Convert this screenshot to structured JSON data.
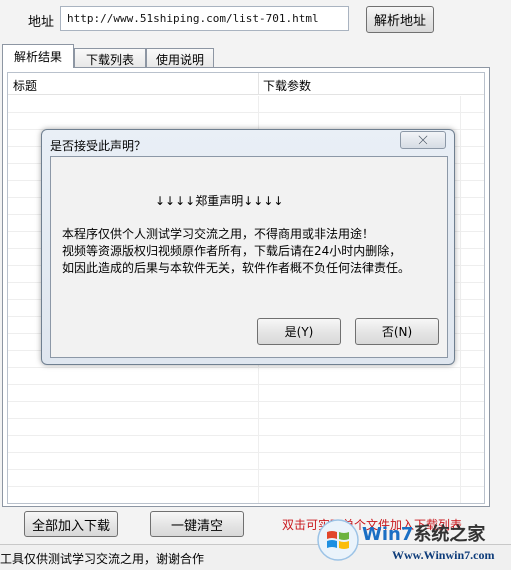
{
  "url_bar": {
    "label": "地址",
    "value": "http://www.51shiping.com/list-701.html",
    "parse_button": "解析地址"
  },
  "tabs": [
    {
      "label": "解析结果",
      "active": true
    },
    {
      "label": "下载列表",
      "active": false
    },
    {
      "label": "使用说明",
      "active": false
    }
  ],
  "list": {
    "columns": [
      "标题",
      "下载参数"
    ]
  },
  "bottom": {
    "add_all_button": "全部加入下载",
    "clear_button": "一键清空",
    "hint": "双击可实现单个文件加入下载列表"
  },
  "status_bar": {
    "text": "工具仅供测试学习交流之用，谢谢合作"
  },
  "dialog": {
    "title": "是否接受此声明？",
    "heading": "↓↓↓↓郑重声明↓↓↓↓",
    "lines": [
      "本程序仅供个人测试学习交流之用，不得商用或非法用途！",
      "视频等资源版权归视频原作者所有，下载后请在24小时内删除，",
      "如因此造成的后果与本软件无关，软件作者概不负任何法律责任。"
    ],
    "yes_button": "是(Y)",
    "no_button": "否(N)"
  },
  "watermark": {
    "brand_prefix": "Win7",
    "brand_suffix": "系统之家",
    "url": "Www.Winwin7.com"
  },
  "colors": {
    "hint_red": "#c9171c",
    "watermark_blue": "#1a6fc4"
  }
}
